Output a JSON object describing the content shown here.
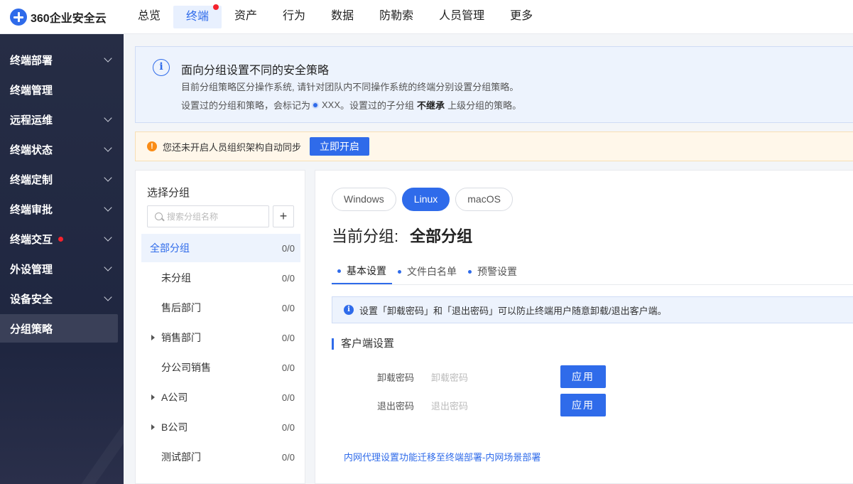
{
  "app": {
    "logo_text": "360企业安全云"
  },
  "topnav": {
    "items": [
      {
        "label": "总览",
        "active": false,
        "dot": false
      },
      {
        "label": "终端",
        "active": true,
        "dot": true
      },
      {
        "label": "资产",
        "active": false,
        "dot": false
      },
      {
        "label": "行为",
        "active": false,
        "dot": false
      },
      {
        "label": "数据",
        "active": false,
        "dot": false
      },
      {
        "label": "防勒索",
        "active": false,
        "dot": false
      },
      {
        "label": "人员管理",
        "active": false,
        "dot": false
      },
      {
        "label": "更多",
        "active": false,
        "dot": false
      }
    ]
  },
  "sidebar": {
    "items": [
      {
        "label": "终端部署",
        "chevron": true
      },
      {
        "label": "终端管理",
        "chevron": false
      },
      {
        "label": "远程运维",
        "chevron": true
      },
      {
        "label": "终端状态",
        "chevron": true
      },
      {
        "label": "终端定制",
        "chevron": true
      },
      {
        "label": "终端审批",
        "chevron": true
      },
      {
        "label": "终端交互",
        "chevron": true,
        "dot": true
      },
      {
        "label": "外设管理",
        "chevron": true
      },
      {
        "label": "设备安全",
        "chevron": true
      },
      {
        "label": "分组策略",
        "chevron": false,
        "active": true
      }
    ]
  },
  "info_banner": {
    "title": "面向分组设置不同的安全策略",
    "line1": "目前分组策略区分操作系统, 请针对团队内不同操作系统的终端分别设置分组策略。",
    "line2_prefix": "设置过的分组和策略，会标记为",
    "line2_marker": "XXX",
    "line2_middle": "。设置过的子分组",
    "line2_bold": "不继承",
    "line2_suffix": "上级分组的策略。"
  },
  "warn_banner": {
    "text": "您还未开启人员组织架构自动同步",
    "button": "立即开启"
  },
  "group_panel": {
    "heading": "选择分组",
    "search_placeholder": "搜索分组名称",
    "add_label": "+",
    "groups": [
      {
        "name": "全部分组",
        "count": "0/0",
        "active": true,
        "root": true,
        "caret": false
      },
      {
        "name": "未分组",
        "count": "0/0",
        "caret": false
      },
      {
        "name": "售后部门",
        "count": "0/0",
        "caret": false
      },
      {
        "name": "销售部门",
        "count": "0/0",
        "caret": true
      },
      {
        "name": "分公司销售",
        "count": "0/0",
        "caret": false
      },
      {
        "name": "A公司",
        "count": "0/0",
        "caret": true
      },
      {
        "name": "B公司",
        "count": "0/0",
        "caret": true
      },
      {
        "name": "测试部门",
        "count": "0/0",
        "caret": false
      }
    ]
  },
  "content": {
    "os_tabs": [
      {
        "label": "Windows",
        "active": false
      },
      {
        "label": "Linux",
        "active": true
      },
      {
        "label": "macOS",
        "active": false
      }
    ],
    "current_group_label": "当前分组:",
    "current_group_value": "全部分组",
    "sub_tabs": [
      {
        "label": "基本设置",
        "active": true
      },
      {
        "label": "文件白名单",
        "active": false
      },
      {
        "label": "预警设置",
        "active": false
      }
    ],
    "tip": "设置「卸载密码」和「退出密码」可以防止终端用户随意卸载/退出客户端。",
    "section_title": "客户端设置",
    "fields": [
      {
        "label": "卸载密码",
        "placeholder": "卸载密码",
        "button": "应用"
      },
      {
        "label": "退出密码",
        "placeholder": "退出密码",
        "button": "应用"
      }
    ],
    "link": "内网代理设置功能迁移至终端部署-内网场景部署"
  },
  "colors": {
    "accent": "#2f6bea",
    "sidebar_bg": "#262d45",
    "warn": "#fa8c16",
    "alert_dot": "#f5222d"
  }
}
